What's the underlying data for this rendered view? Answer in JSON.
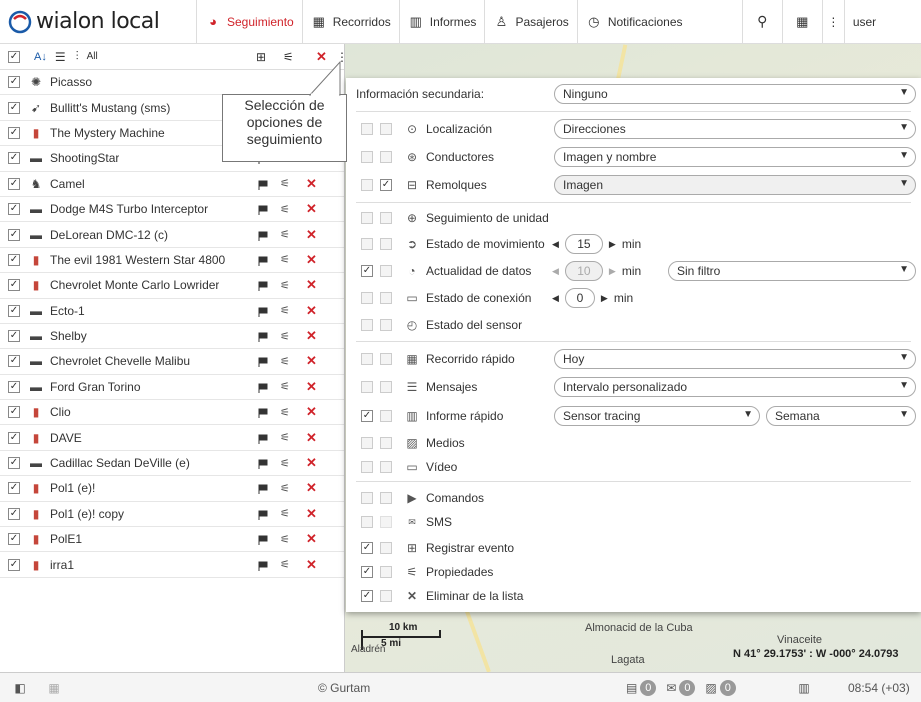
{
  "app": {
    "brand": "wialon local"
  },
  "nav": [
    {
      "label": "Seguimiento",
      "icon": "globe-icon"
    },
    {
      "label": "Recorridos",
      "icon": "checkered-flag-icon"
    },
    {
      "label": "Informes",
      "icon": "report-icon"
    },
    {
      "label": "Pasajeros",
      "icon": "passenger-icon"
    },
    {
      "label": "Notificaciones",
      "icon": "alarm-icon"
    }
  ],
  "user": {
    "label": "user"
  },
  "units": [
    {
      "name": "Picasso",
      "icon": "picasso-icon"
    },
    {
      "name": "Bullitt's Mustang (sms)",
      "icon": "mustang-icon"
    },
    {
      "name": "The Mystery Machine",
      "icon": "pin-icon"
    },
    {
      "name": "ShootingStar",
      "icon": "car-icon"
    },
    {
      "name": "Camel",
      "icon": "camel-icon"
    },
    {
      "name": "Dodge M4S Turbo Interceptor",
      "icon": "car-icon"
    },
    {
      "name": "DeLorean DMC-12 (c)",
      "icon": "car-icon"
    },
    {
      "name": "The evil 1981 Western Star 4800",
      "icon": "pin-icon"
    },
    {
      "name": "Chevrolet Monte Carlo Lowrider",
      "icon": "pin-icon"
    },
    {
      "name": "Ecto-1",
      "icon": "car-icon"
    },
    {
      "name": "Shelby",
      "icon": "car-icon"
    },
    {
      "name": "Chevrolet Chevelle Malibu",
      "icon": "car-icon"
    },
    {
      "name": "Ford Gran Torino",
      "icon": "car-icon"
    },
    {
      "name": "Clio",
      "icon": "pin-icon"
    },
    {
      "name": "DAVE",
      "icon": "pin-icon"
    },
    {
      "name": "Cadillac Sedan DeVille (e)",
      "icon": "car-icon"
    },
    {
      "name": "Pol1 (e)!",
      "icon": "pin-icon"
    },
    {
      "name": "Pol1 (e)! copy",
      "icon": "pin-icon"
    },
    {
      "name": "PolE1",
      "icon": "pin-icon"
    },
    {
      "name": "irra1",
      "icon": "pin-icon"
    }
  ],
  "tooltip": {
    "line1": "Selección de",
    "line2": "opciones de",
    "line3": "seguimiento"
  },
  "menu": {
    "info_label": "Información secundaria:",
    "info_value": "Ninguno",
    "location": {
      "label": "Localización",
      "value": "Direcciones"
    },
    "drivers": {
      "label": "Conductores",
      "value": "Imagen y nombre"
    },
    "trailers": {
      "label": "Remolques",
      "value": "Imagen"
    },
    "unit_tracking": {
      "label": "Seguimiento de unidad"
    },
    "motion": {
      "label": "Estado de movimiento",
      "value": "15",
      "unit": "min"
    },
    "data_actuality": {
      "label": "Actualidad de datos",
      "value": "10",
      "unit": "min",
      "filter": "Sin filtro"
    },
    "connection": {
      "label": "Estado de conexión",
      "value": "0",
      "unit": "min"
    },
    "sensor": {
      "label": "Estado del sensor"
    },
    "quick_track": {
      "label": "Recorrido rápido",
      "value": "Hoy"
    },
    "messages": {
      "label": "Mensajes",
      "value": "Intervalo personalizado"
    },
    "quick_report": {
      "label": "Informe rápido",
      "value": "Sensor tracing",
      "period": "Semana"
    },
    "media": {
      "label": "Medios"
    },
    "video": {
      "label": "Vídeo"
    },
    "commands": {
      "label": "Comandos"
    },
    "sms": {
      "label": "SMS"
    },
    "register_event": {
      "label": "Registrar evento"
    },
    "properties": {
      "label": "Propiedades"
    },
    "remove": {
      "label": "Eliminar de la lista"
    }
  },
  "map": {
    "scale_km": "10 km",
    "scale_mi": "5 mi",
    "places": [
      "Almonacid de la Cuba",
      "Vinaceite",
      "Lagata",
      "Aladrén"
    ],
    "coords": "N 41° 29.1753' : W -000° 24.0793"
  },
  "footer": {
    "copyright": "© Gurtam",
    "count1": "0",
    "count2": "0",
    "count3": "0",
    "time": "08:54 (+03)"
  },
  "colors": {
    "accent": "#d0232a",
    "brand": "#1a5aa8"
  }
}
